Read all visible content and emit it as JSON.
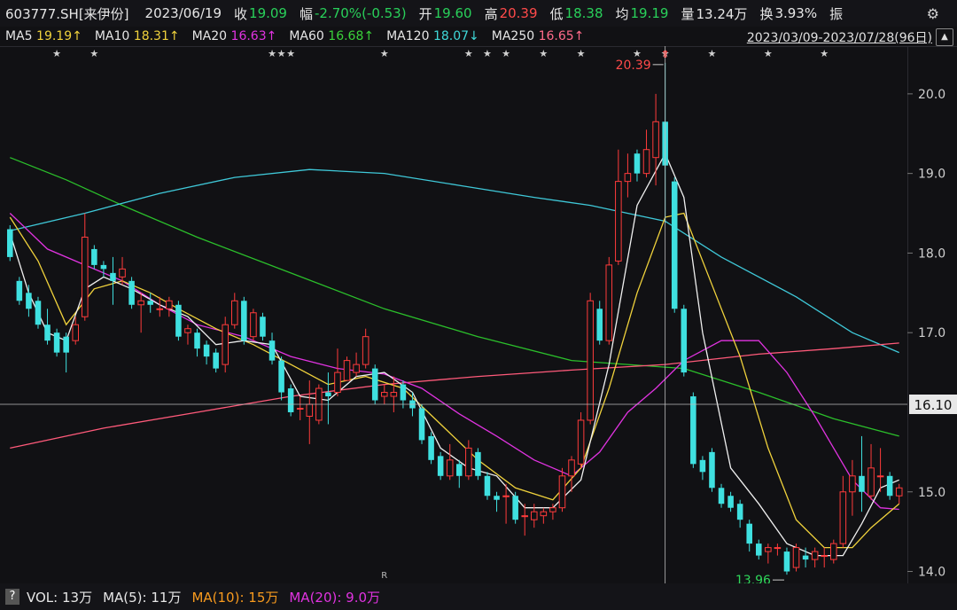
{
  "header": {
    "symbol": "603777.SH[来伊份]",
    "date": "2023/06/19",
    "close_label": "收",
    "close": "19.09",
    "amp_label": "幅",
    "amp": "-2.70%(-0.53)",
    "open_label": "开",
    "open": "19.60",
    "high_label": "高",
    "high": "20.39",
    "low_label": "低",
    "low": "18.38",
    "avg_label": "均",
    "avg": "19.19",
    "vol_label": "量",
    "vol": "13.24万",
    "turn_label": "换",
    "turn": "3.93%",
    "swing_label": "振"
  },
  "ma_bar": {
    "ma5": "MA5",
    "ma5_val": "19.19↑",
    "ma10": "MA10",
    "ma10_val": "18.31↑",
    "ma20": "MA20",
    "ma20_val": "16.63↑",
    "ma60": "MA60",
    "ma60_val": "16.68↑",
    "ma120": "MA120",
    "ma120_val": "18.07↓",
    "ma250": "MA250",
    "ma250_val": "16.65↑",
    "range": "2023/03/09-2023/07/28(96日)"
  },
  "volume_bar": {
    "q": "?",
    "vol": "VOL: 13万",
    "ma5": "MA(5): 11万",
    "ma10": "MA(10): 15万",
    "ma20": "MA(20): 9.0万"
  },
  "colors": {
    "up": "#ff3b3b",
    "down": "#3fe0e0",
    "ma5": "#f0f0f0",
    "ma10": "#f0d23c",
    "ma20": "#e033e0",
    "ma60": "#2bbf2b",
    "ma120": "#3fc8d8",
    "ma250": "#ff5a7a"
  },
  "chart_data": {
    "type": "candlestick",
    "ylim": [
      13.85,
      20.6
    ],
    "y_ticks": [
      "20.0",
      "19.0",
      "18.0",
      "17.0",
      "15.0",
      "14.0"
    ],
    "crosshair_price": "16.10",
    "annotations": {
      "high": "20.39",
      "low": "13.96",
      "r_marker": "R"
    },
    "candles": [
      {
        "o": 18.3,
        "c": 17.95,
        "h": 18.35,
        "l": 17.9
      },
      {
        "o": 17.65,
        "c": 17.4,
        "h": 17.7,
        "l": 17.35
      },
      {
        "o": 17.5,
        "c": 17.3,
        "h": 17.6,
        "l": 17.2
      },
      {
        "o": 17.4,
        "c": 17.1,
        "h": 17.45,
        "l": 17.05
      },
      {
        "o": 17.1,
        "c": 16.9,
        "h": 17.3,
        "l": 16.85
      },
      {
        "o": 17.0,
        "c": 16.75,
        "h": 17.05,
        "l": 16.7
      },
      {
        "o": 16.95,
        "c": 16.75,
        "h": 17.0,
        "l": 16.5
      },
      {
        "o": 16.9,
        "c": 17.1,
        "h": 17.2,
        "l": 16.85
      },
      {
        "o": 17.2,
        "c": 18.2,
        "h": 18.5,
        "l": 17.15
      },
      {
        "o": 18.05,
        "c": 17.85,
        "h": 18.1,
        "l": 17.8
      },
      {
        "o": 17.85,
        "c": 17.8,
        "h": 17.9,
        "l": 17.7
      },
      {
        "o": 17.75,
        "c": 17.65,
        "h": 17.95,
        "l": 17.35
      },
      {
        "o": 17.7,
        "c": 17.8,
        "h": 17.95,
        "l": 17.6
      },
      {
        "o": 17.65,
        "c": 17.35,
        "h": 17.7,
        "l": 17.3
      },
      {
        "o": 17.35,
        "c": 17.4,
        "h": 17.5,
        "l": 17.0
      },
      {
        "o": 17.4,
        "c": 17.35,
        "h": 17.5,
        "l": 17.25
      },
      {
        "o": 17.3,
        "c": 17.3,
        "h": 17.45,
        "l": 17.2
      },
      {
        "o": 17.3,
        "c": 17.4,
        "h": 17.45,
        "l": 17.2
      },
      {
        "o": 17.35,
        "c": 16.95,
        "h": 17.4,
        "l": 16.9
      },
      {
        "o": 17.0,
        "c": 17.05,
        "h": 17.1,
        "l": 16.85
      },
      {
        "o": 17.0,
        "c": 16.8,
        "h": 17.05,
        "l": 16.7
      },
      {
        "o": 16.85,
        "c": 16.7,
        "h": 16.9,
        "l": 16.6
      },
      {
        "o": 16.75,
        "c": 16.55,
        "h": 16.8,
        "l": 16.5
      },
      {
        "o": 16.6,
        "c": 17.1,
        "h": 17.2,
        "l": 16.5
      },
      {
        "o": 17.1,
        "c": 17.4,
        "h": 17.5,
        "l": 17.05
      },
      {
        "o": 17.4,
        "c": 16.9,
        "h": 17.45,
        "l": 16.85
      },
      {
        "o": 16.95,
        "c": 17.25,
        "h": 17.3,
        "l": 16.9
      },
      {
        "o": 17.2,
        "c": 16.95,
        "h": 17.25,
        "l": 16.9
      },
      {
        "o": 16.9,
        "c": 16.65,
        "h": 17.0,
        "l": 16.6
      },
      {
        "o": 16.65,
        "c": 16.25,
        "h": 16.7,
        "l": 16.15
      },
      {
        "o": 16.3,
        "c": 16.0,
        "h": 16.35,
        "l": 15.95
      },
      {
        "o": 16.05,
        "c": 16.05,
        "h": 16.2,
        "l": 15.9
      },
      {
        "o": 15.95,
        "c": 16.1,
        "h": 16.4,
        "l": 15.6
      },
      {
        "o": 15.9,
        "c": 16.3,
        "h": 16.35,
        "l": 15.85
      },
      {
        "o": 16.25,
        "c": 16.2,
        "h": 16.5,
        "l": 15.85
      },
      {
        "o": 16.25,
        "c": 16.5,
        "h": 16.8,
        "l": 16.2
      },
      {
        "o": 16.4,
        "c": 16.65,
        "h": 16.7,
        "l": 16.4
      },
      {
        "o": 16.5,
        "c": 16.6,
        "h": 16.75,
        "l": 16.45
      },
      {
        "o": 16.6,
        "c": 16.95,
        "h": 17.05,
        "l": 16.55
      },
      {
        "o": 16.55,
        "c": 16.15,
        "h": 16.6,
        "l": 16.1
      },
      {
        "o": 16.2,
        "c": 16.25,
        "h": 16.35,
        "l": 16.1
      },
      {
        "o": 16.2,
        "c": 16.25,
        "h": 16.45,
        "l": 16.0
      },
      {
        "o": 16.35,
        "c": 16.15,
        "h": 16.4,
        "l": 16.05
      },
      {
        "o": 16.15,
        "c": 16.05,
        "h": 16.25,
        "l": 15.95
      },
      {
        "o": 16.05,
        "c": 15.65,
        "h": 16.1,
        "l": 15.6
      },
      {
        "o": 15.7,
        "c": 15.4,
        "h": 15.75,
        "l": 15.35
      },
      {
        "o": 15.45,
        "c": 15.2,
        "h": 15.5,
        "l": 15.15
      },
      {
        "o": 15.2,
        "c": 15.4,
        "h": 15.6,
        "l": 15.15
      },
      {
        "o": 15.35,
        "c": 15.2,
        "h": 15.4,
        "l": 15.05
      },
      {
        "o": 15.2,
        "c": 15.55,
        "h": 15.65,
        "l": 15.15
      },
      {
        "o": 15.5,
        "c": 15.2,
        "h": 15.55,
        "l": 15.15
      },
      {
        "o": 15.2,
        "c": 14.95,
        "h": 15.25,
        "l": 14.9
      },
      {
        "o": 14.95,
        "c": 14.9,
        "h": 15.0,
        "l": 14.75
      },
      {
        "o": 14.95,
        "c": 14.95,
        "h": 15.1,
        "l": 14.6
      },
      {
        "o": 14.95,
        "c": 14.65,
        "h": 15.0,
        "l": 14.6
      },
      {
        "o": 14.7,
        "c": 14.7,
        "h": 14.85,
        "l": 14.45
      },
      {
        "o": 14.65,
        "c": 14.75,
        "h": 14.85,
        "l": 14.55
      },
      {
        "o": 14.7,
        "c": 14.75,
        "h": 14.8,
        "l": 14.6
      },
      {
        "o": 14.75,
        "c": 14.8,
        "h": 14.85,
        "l": 14.65
      },
      {
        "o": 14.8,
        "c": 15.2,
        "h": 15.3,
        "l": 14.75
      },
      {
        "o": 15.2,
        "c": 15.4,
        "h": 15.45,
        "l": 15.0
      },
      {
        "o": 15.35,
        "c": 15.9,
        "h": 16.0,
        "l": 15.3
      },
      {
        "o": 15.9,
        "c": 17.4,
        "h": 17.5,
        "l": 15.85
      },
      {
        "o": 17.3,
        "c": 16.9,
        "h": 17.4,
        "l": 16.85
      },
      {
        "o": 16.9,
        "c": 17.85,
        "h": 17.95,
        "l": 16.85
      },
      {
        "o": 17.9,
        "c": 18.9,
        "h": 19.3,
        "l": 17.85
      },
      {
        "o": 18.9,
        "c": 19.0,
        "h": 19.25,
        "l": 18.7
      },
      {
        "o": 19.25,
        "c": 19.0,
        "h": 19.3,
        "l": 18.9
      },
      {
        "o": 19.0,
        "c": 19.3,
        "h": 19.55,
        "l": 18.95
      },
      {
        "o": 19.2,
        "c": 19.65,
        "h": 20.0,
        "l": 18.85
      },
      {
        "o": 19.65,
        "c": 19.1,
        "h": 20.39,
        "l": 18.38
      },
      {
        "o": 18.9,
        "c": 17.3,
        "h": 18.95,
        "l": 17.25
      },
      {
        "o": 17.3,
        "c": 16.5,
        "h": 17.35,
        "l": 16.45
      },
      {
        "o": 16.2,
        "c": 15.35,
        "h": 16.25,
        "l": 15.3
      },
      {
        "o": 15.4,
        "c": 15.25,
        "h": 15.45,
        "l": 15.15
      },
      {
        "o": 15.5,
        "c": 15.05,
        "h": 15.55,
        "l": 15.0
      },
      {
        "o": 15.05,
        "c": 14.85,
        "h": 15.1,
        "l": 14.8
      },
      {
        "o": 14.95,
        "c": 14.8,
        "h": 15.0,
        "l": 14.75
      },
      {
        "o": 14.85,
        "c": 14.65,
        "h": 14.9,
        "l": 14.55
      },
      {
        "o": 14.6,
        "c": 14.35,
        "h": 14.65,
        "l": 14.25
      },
      {
        "o": 14.35,
        "c": 14.2,
        "h": 14.4,
        "l": 14.15
      },
      {
        "o": 14.25,
        "c": 14.3,
        "h": 14.35,
        "l": 14.1
      },
      {
        "o": 14.3,
        "c": 14.3,
        "h": 14.35,
        "l": 14.2
      },
      {
        "o": 14.25,
        "c": 14.0,
        "h": 14.3,
        "l": 13.96
      },
      {
        "o": 14.05,
        "c": 14.3,
        "h": 14.35,
        "l": 14.0
      },
      {
        "o": 14.2,
        "c": 14.15,
        "h": 14.3,
        "l": 14.05
      },
      {
        "o": 14.15,
        "c": 14.25,
        "h": 14.3,
        "l": 14.05
      },
      {
        "o": 14.2,
        "c": 14.2,
        "h": 14.3,
        "l": 14.05
      },
      {
        "o": 14.15,
        "c": 14.35,
        "h": 14.4,
        "l": 14.1
      },
      {
        "o": 14.35,
        "c": 15.0,
        "h": 15.2,
        "l": 14.3
      },
      {
        "o": 15.0,
        "c": 15.2,
        "h": 15.4,
        "l": 14.7
      },
      {
        "o": 15.2,
        "c": 15.0,
        "h": 15.7,
        "l": 14.75
      },
      {
        "o": 14.95,
        "c": 15.3,
        "h": 15.6,
        "l": 14.9
      },
      {
        "o": 15.2,
        "c": 15.2,
        "h": 15.55,
        "l": 15.0
      },
      {
        "o": 15.2,
        "c": 14.95,
        "h": 15.25,
        "l": 14.9
      },
      {
        "o": 14.95,
        "c": 15.05,
        "h": 15.1,
        "l": 14.85
      }
    ],
    "ma_lines": {
      "ma60": [
        [
          0,
          19.2
        ],
        [
          6,
          18.92
        ],
        [
          12,
          18.6
        ],
        [
          20,
          18.2
        ],
        [
          30,
          17.75
        ],
        [
          40,
          17.3
        ],
        [
          50,
          16.95
        ],
        [
          60,
          16.65
        ],
        [
          66,
          16.6
        ],
        [
          72,
          16.55
        ],
        [
          80,
          16.25
        ],
        [
          88,
          15.92
        ],
        [
          95,
          15.7
        ]
      ],
      "ma120": [
        [
          0,
          18.28
        ],
        [
          8,
          18.5
        ],
        [
          16,
          18.75
        ],
        [
          24,
          18.95
        ],
        [
          32,
          19.05
        ],
        [
          40,
          19.0
        ],
        [
          48,
          18.85
        ],
        [
          56,
          18.7
        ],
        [
          62,
          18.6
        ],
        [
          70,
          18.4
        ],
        [
          76,
          17.95
        ],
        [
          84,
          17.45
        ],
        [
          90,
          17.0
        ],
        [
          95,
          16.75
        ]
      ],
      "ma250": [
        [
          0,
          15.55
        ],
        [
          10,
          15.8
        ],
        [
          20,
          16.0
        ],
        [
          30,
          16.2
        ],
        [
          40,
          16.35
        ],
        [
          50,
          16.45
        ],
        [
          60,
          16.53
        ],
        [
          70,
          16.6
        ],
        [
          80,
          16.73
        ],
        [
          88,
          16.8
        ],
        [
          95,
          16.87
        ]
      ],
      "ma20": [
        [
          0,
          18.5
        ],
        [
          4,
          18.05
        ],
        [
          8,
          17.85
        ],
        [
          12,
          17.65
        ],
        [
          16,
          17.35
        ],
        [
          20,
          17.1
        ],
        [
          25,
          16.95
        ],
        [
          30,
          16.7
        ],
        [
          35,
          16.55
        ],
        [
          40,
          16.48
        ],
        [
          44,
          16.3
        ],
        [
          48,
          15.98
        ],
        [
          52,
          15.7
        ],
        [
          56,
          15.4
        ],
        [
          60,
          15.2
        ],
        [
          63,
          15.5
        ],
        [
          66,
          16.0
        ],
        [
          69,
          16.3
        ],
        [
          72,
          16.65
        ],
        [
          76,
          16.9
        ],
        [
          80,
          16.9
        ],
        [
          83,
          16.5
        ],
        [
          86,
          15.95
        ],
        [
          88,
          15.55
        ],
        [
          90,
          15.15
        ],
        [
          93,
          14.8
        ],
        [
          95,
          14.78
        ]
      ],
      "ma10": [
        [
          0,
          18.45
        ],
        [
          3,
          17.9
        ],
        [
          6,
          17.1
        ],
        [
          9,
          17.55
        ],
        [
          12,
          17.65
        ],
        [
          15,
          17.5
        ],
        [
          18,
          17.3
        ],
        [
          22,
          17.05
        ],
        [
          26,
          16.85
        ],
        [
          30,
          16.6
        ],
        [
          34,
          16.35
        ],
        [
          38,
          16.45
        ],
        [
          42,
          16.3
        ],
        [
          46,
          15.85
        ],
        [
          50,
          15.4
        ],
        [
          54,
          15.05
        ],
        [
          58,
          14.9
        ],
        [
          61,
          15.3
        ],
        [
          64,
          16.3
        ],
        [
          67,
          17.5
        ],
        [
          70,
          18.45
        ],
        [
          72,
          18.5
        ],
        [
          75,
          17.6
        ],
        [
          78,
          16.7
        ],
        [
          81,
          15.55
        ],
        [
          84,
          14.65
        ],
        [
          87,
          14.3
        ],
        [
          90,
          14.3
        ],
        [
          92,
          14.55
        ],
        [
          95,
          14.85
        ]
      ],
      "ma5": [
        [
          0,
          18.25
        ],
        [
          2,
          17.5
        ],
        [
          4,
          17.0
        ],
        [
          6,
          16.9
        ],
        [
          8,
          17.55
        ],
        [
          10,
          17.7
        ],
        [
          13,
          17.55
        ],
        [
          16,
          17.35
        ],
        [
          19,
          17.2
        ],
        [
          22,
          16.85
        ],
        [
          25,
          16.9
        ],
        [
          28,
          16.85
        ],
        [
          31,
          16.2
        ],
        [
          34,
          16.15
        ],
        [
          37,
          16.45
        ],
        [
          40,
          16.5
        ],
        [
          43,
          16.25
        ],
        [
          46,
          15.55
        ],
        [
          49,
          15.3
        ],
        [
          52,
          15.2
        ],
        [
          55,
          14.8
        ],
        [
          58,
          14.8
        ],
        [
          61,
          15.15
        ],
        [
          64,
          16.6
        ],
        [
          67,
          18.6
        ],
        [
          70,
          19.25
        ],
        [
          72,
          18.7
        ],
        [
          74,
          17.0
        ],
        [
          77,
          15.3
        ],
        [
          80,
          14.85
        ],
        [
          83,
          14.35
        ],
        [
          86,
          14.2
        ],
        [
          89,
          14.2
        ],
        [
          91,
          14.6
        ],
        [
          93,
          15.05
        ],
        [
          95,
          15.15
        ]
      ]
    },
    "stars_at": [
      5,
      9,
      28,
      29,
      30,
      40,
      49,
      51,
      53,
      57,
      61,
      67,
      70,
      75,
      81,
      87
    ],
    "up_arrow_at": 70
  }
}
